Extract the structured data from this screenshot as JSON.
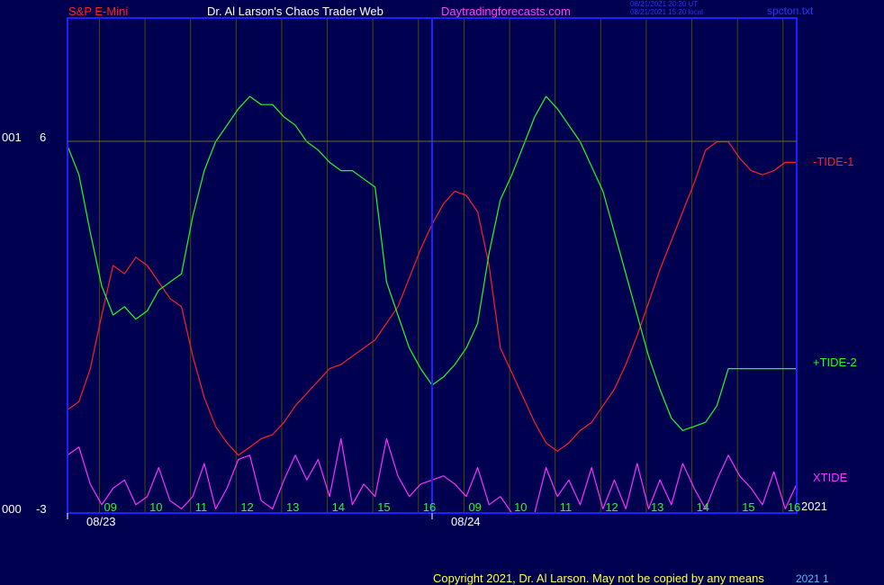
{
  "header": {
    "symbol": "S&P E-Mini",
    "site_name": "Dr. Al Larson's Chaos Trader Web",
    "site_url": "Daytradingforecasts.com",
    "timestamp_ut": "08/21/2021 20:20 UT",
    "timestamp_local": "08/21/2021 15:20 local",
    "file": "spcton.txt"
  },
  "colors": {
    "background": "#000050",
    "frame": "#2020ff",
    "grid": "#4a4a00",
    "tide1": "#ff2020",
    "tide2": "#20ff20",
    "xtide": "#ff30ff",
    "header_red": "#ff2020",
    "header_white": "#ffffff",
    "header_magenta": "#ff40ff",
    "header_blue": "#3030ff",
    "footer": "#ffff40",
    "axis_text": "#ffffff",
    "axis_green": "#20ff20"
  },
  "footer": {
    "copyright": "Copyright 2021, Dr. Al Larson. May not be copied by any means",
    "overlap": "2021 1"
  },
  "left_axis": {
    "top_label_a": "001",
    "top_label_b": "6",
    "bottom_label_a": "000",
    "bottom_label_b": "-3"
  },
  "chart_data": {
    "type": "line",
    "ylim": [
      -3,
      9
    ],
    "x": [
      0,
      0.25,
      0.5,
      0.75,
      1,
      1.25,
      1.5,
      1.75,
      2,
      2.25,
      2.5,
      2.75,
      3,
      3.25,
      3.5,
      3.75,
      4,
      4.25,
      4.5,
      4.75,
      5,
      5.25,
      5.5,
      5.75,
      6,
      6.25,
      6.5,
      6.75,
      7,
      7.25,
      7.5,
      7.75,
      8,
      8.25,
      8.5,
      8.75,
      9,
      9.25,
      9.5,
      9.75,
      10,
      10.25,
      10.5,
      10.75,
      11,
      11.25,
      11.5,
      11.75,
      12,
      12.25,
      12.5,
      12.75,
      13,
      13.25,
      13.5,
      13.75,
      14,
      14.25,
      14.5,
      14.75,
      15,
      15.25,
      15.5,
      15.75,
      16
    ],
    "x_tick_positions": [
      0.7,
      1.7,
      2.7,
      3.7,
      4.7,
      5.7,
      6.7,
      7.7,
      8.7,
      9.7,
      10.7,
      11.7,
      12.7,
      13.7,
      14.7,
      15.7
    ],
    "x_tick_labels": [
      "09",
      "10",
      "11",
      "12",
      "13",
      "14",
      "15",
      "16",
      "09",
      "10",
      "11",
      "12",
      "13",
      "14",
      "15",
      "16"
    ],
    "date_positions": [
      0,
      8
    ],
    "date_labels": [
      "08/23",
      "08/24"
    ],
    "year_label": "2021",
    "series": [
      {
        "name": "-TIDE-1",
        "color": "#ff2020",
        "values": [
          -0.5,
          -0.3,
          0.5,
          1.8,
          3.0,
          2.8,
          3.2,
          3.0,
          2.6,
          2.2,
          2.0,
          0.8,
          -0.2,
          -0.9,
          -1.3,
          -1.6,
          -1.4,
          -1.2,
          -1.1,
          -0.8,
          -0.4,
          -0.1,
          0.2,
          0.5,
          0.6,
          0.8,
          1.0,
          1.2,
          1.6,
          2.0,
          2.7,
          3.4,
          4.0,
          4.5,
          4.8,
          4.7,
          4.3,
          3.0,
          1.0,
          0.4,
          -0.2,
          -0.8,
          -1.3,
          -1.5,
          -1.3,
          -1.0,
          -0.8,
          -0.4,
          0.0,
          0.6,
          1.3,
          2.1,
          2.9,
          3.6,
          4.3,
          5.0,
          5.8,
          6.0,
          6.0,
          5.6,
          5.3,
          5.2,
          5.3,
          5.5,
          5.5
        ]
      },
      {
        "name": "+TIDE-2",
        "color": "#20ff20",
        "values": [
          5.9,
          5.2,
          3.8,
          2.5,
          1.8,
          2.0,
          1.7,
          1.9,
          2.4,
          2.6,
          2.8,
          4.2,
          5.3,
          6.0,
          6.4,
          6.8,
          7.1,
          6.9,
          6.9,
          6.6,
          6.4,
          6.0,
          5.8,
          5.5,
          5.3,
          5.3,
          5.1,
          4.9,
          2.6,
          1.8,
          1.0,
          0.5,
          0.1,
          0.3,
          0.6,
          1.0,
          1.6,
          3.3,
          4.6,
          5.2,
          5.9,
          6.6,
          7.1,
          6.8,
          6.4,
          6.0,
          5.4,
          4.8,
          3.8,
          2.8,
          1.8,
          0.8,
          0.0,
          -0.7,
          -1.0,
          -0.9,
          -0.8,
          -0.4,
          0.5,
          0.5,
          0.5,
          0.5,
          0.5,
          0.5,
          0.5
        ]
      },
      {
        "name": "XTIDE",
        "color": "#ff30ff",
        "values": [
          -1.6,
          -1.4,
          -2.3,
          -2.8,
          -2.4,
          -2.2,
          -2.8,
          -2.6,
          -1.9,
          -2.7,
          -2.9,
          -2.6,
          -1.8,
          -2.9,
          -2.4,
          -1.7,
          -1.6,
          -2.7,
          -2.9,
          -2.2,
          -1.6,
          -2.2,
          -1.7,
          -2.6,
          -1.2,
          -2.8,
          -2.3,
          -2.6,
          -1.2,
          -2.1,
          -2.6,
          -2.3,
          -2.2,
          -2.1,
          -2.3,
          -2.6,
          -1.9,
          -2.8,
          -2.6,
          -3.0,
          -3.0,
          -3.0,
          -1.9,
          -2.6,
          -2.2,
          -2.8,
          -1.9,
          -2.9,
          -2.2,
          -2.9,
          -1.8,
          -2.9,
          -2.2,
          -2.8,
          -1.8,
          -2.4,
          -2.9,
          -2.2,
          -1.6,
          -2.1,
          -2.4,
          -2.8,
          -2.0,
          -2.9,
          -2.3
        ]
      }
    ]
  }
}
